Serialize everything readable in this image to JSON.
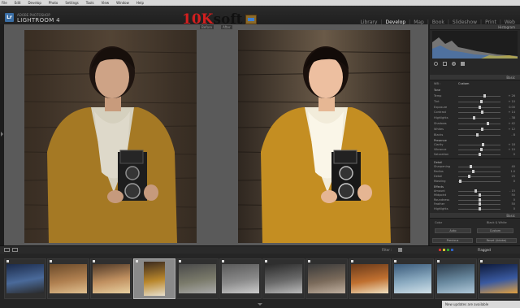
{
  "menubar": [
    "File",
    "Edit",
    "Develop",
    "Photo",
    "Settings",
    "Tools",
    "View",
    "Window",
    "Help"
  ],
  "identity": {
    "logo_text": "Lr",
    "subtitle": "ADOBE PHOTOSHOP",
    "title": "LIGHTROOM 4"
  },
  "watermark": {
    "part1": "10K",
    "part2": "soft"
  },
  "modules": [
    {
      "label": "Library",
      "active": false
    },
    {
      "label": "Develop",
      "active": true
    },
    {
      "label": "Map",
      "active": false
    },
    {
      "label": "Book",
      "active": false
    },
    {
      "label": "Slideshow",
      "active": false
    },
    {
      "label": "Print",
      "active": false
    },
    {
      "label": "Web",
      "active": false
    }
  ],
  "view": {
    "before_label": "Before",
    "after_label": "After"
  },
  "right_panel": {
    "histogram_title": "Histogram",
    "basic": {
      "title": "Basic",
      "treatment_left": "Color",
      "treatment_right": "Black & White"
    },
    "wb_label": "WB :",
    "wb_value": "Custom",
    "tone_header": "Tone",
    "tone_auto": "Auto",
    "sliders_a": [
      {
        "label": "Temp",
        "value": "+ 26",
        "pos": 0.62
      },
      {
        "label": "Tint",
        "value": "+ 10",
        "pos": 0.55
      },
      {
        "label": "Exposure",
        "value": "0.00",
        "pos": 0.5
      },
      {
        "label": "Contrast",
        "value": "+ 14",
        "pos": 0.57
      },
      {
        "label": "Highlights",
        "value": "- 38",
        "pos": 0.38
      },
      {
        "label": "Shadows",
        "value": "+ 42",
        "pos": 0.7
      },
      {
        "label": "Whites",
        "value": "+ 12",
        "pos": 0.56
      },
      {
        "label": "Blacks",
        "value": "- 8",
        "pos": 0.46
      }
    ],
    "presence_header": "Presence",
    "sliders_b": [
      {
        "label": "Clarity",
        "value": "+ 18",
        "pos": 0.59
      },
      {
        "label": "Vibrance",
        "value": "+ 10",
        "pos": 0.55
      },
      {
        "label": "Saturation",
        "value": "0",
        "pos": 0.5
      }
    ],
    "detail_header": "Detail",
    "sliders_c": [
      {
        "label": "Sharpening",
        "value": "40",
        "pos": 0.3
      },
      {
        "label": "Radius",
        "value": "1.0",
        "pos": 0.35
      },
      {
        "label": "Detail",
        "value": "25",
        "pos": 0.25
      },
      {
        "label": "Masking",
        "value": "0",
        "pos": 0.05
      }
    ],
    "effects_header": "Effects",
    "sliders_d": [
      {
        "label": "Amount",
        "value": "- 15",
        "pos": 0.42
      },
      {
        "label": "Midpoint",
        "value": "50",
        "pos": 0.5
      },
      {
        "label": "Roundness",
        "value": "0",
        "pos": 0.5
      },
      {
        "label": "Feather",
        "value": "50",
        "pos": 0.5
      },
      {
        "label": "Highlights",
        "value": "0",
        "pos": 0.5
      }
    ],
    "btn_previous": "Previous",
    "btn_reset": "Reset (Adobe)",
    "btn_auto": "Auto",
    "btn_custom": "Custom"
  },
  "toolbar": {
    "filter_label": "Filter :",
    "filter_value": "Flagged"
  },
  "filmstrip": {
    "count": 12,
    "selected_index": 3
  },
  "status": {
    "update_text": "New updates are available"
  },
  "colors": {
    "accent": "#3a6ea5",
    "watermark_red": "#d21f1f",
    "coat": "#b9872c"
  }
}
